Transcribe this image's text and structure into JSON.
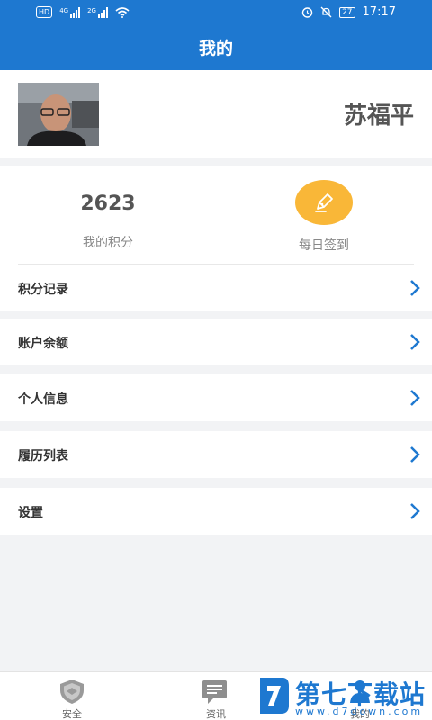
{
  "status_bar": {
    "hd": "HD",
    "net1": "4G",
    "net2": "2G",
    "battery": "27",
    "time": "17:17"
  },
  "header": {
    "title": "我的"
  },
  "profile": {
    "name": "苏福平"
  },
  "stats": {
    "points_value": "2623",
    "points_label": "我的积分",
    "sign_in_label": "每日签到"
  },
  "menu": {
    "items": [
      {
        "label": "积分记录"
      },
      {
        "label": "账户余额"
      },
      {
        "label": "个人信息"
      },
      {
        "label": "履历列表"
      },
      {
        "label": "设置"
      }
    ]
  },
  "tabbar": {
    "tabs": [
      {
        "label": "安全"
      },
      {
        "label": "资讯"
      },
      {
        "label": "我的"
      }
    ]
  },
  "watermark": {
    "title": "第七下载站",
    "url": "www.d7down.com"
  },
  "colors": {
    "primary": "#1e78d0",
    "sign_in": "#f9b738",
    "background": "#f2f3f5"
  }
}
